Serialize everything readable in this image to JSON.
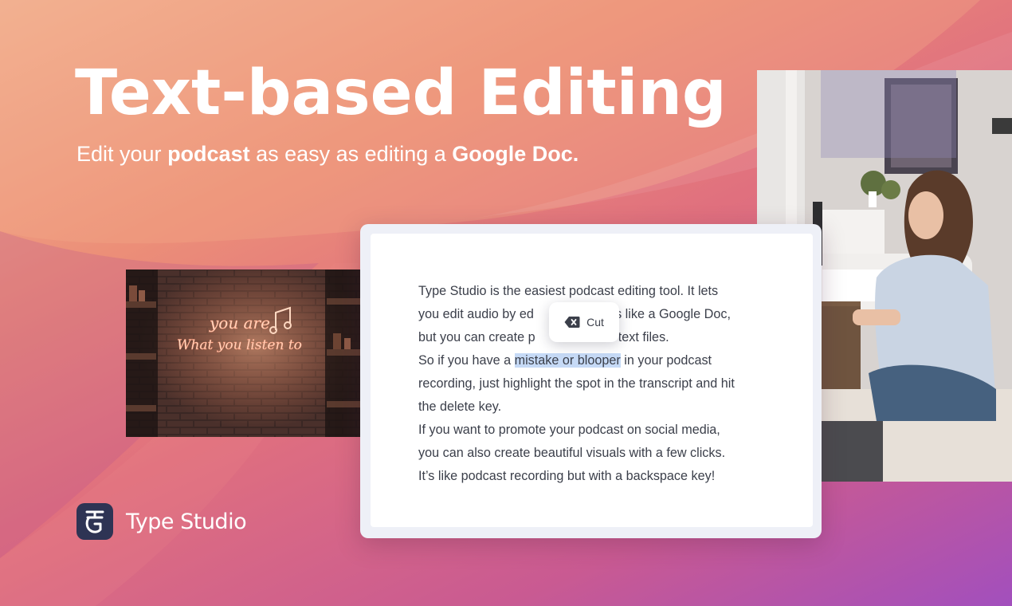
{
  "hero": {
    "title": "Text-based Editing",
    "subtitle": {
      "part1": "Edit your ",
      "bold1": "podcast",
      "part2": " as easy as editing a ",
      "bold2": "Google Doc."
    }
  },
  "neon_photo": {
    "line1": "you are",
    "line2": "What you listen to"
  },
  "editor": {
    "cut_label": "Cut",
    "lines": [
      "Type Studio is the easiest podcast editing tool. It lets",
      "you edit audio by ed",
      "but you can create p",
      "So if you have a ",
      "recording, just highlight the spot in the transcript and hit",
      "the delete key.",
      "If you want to promote your podcast on social media,",
      "you can also create beautiful visuals with a few clicks.",
      "It’s like podcast recording but with a backspace key!"
    ],
    "line2_tail": "works like a Google Doc,",
    "line3_tail": "stead of text files.",
    "highlight": "mistake or blooper",
    "line4_tail": " in your podcast"
  },
  "brand": {
    "name": "Type Studio"
  },
  "colors": {
    "brand_mark": "#2e3454",
    "highlight": "#c6daf6",
    "text": "#3b3f4a"
  },
  "icons": {
    "cut": "backspace-icon",
    "brand": "type-studio-logo-icon"
  }
}
